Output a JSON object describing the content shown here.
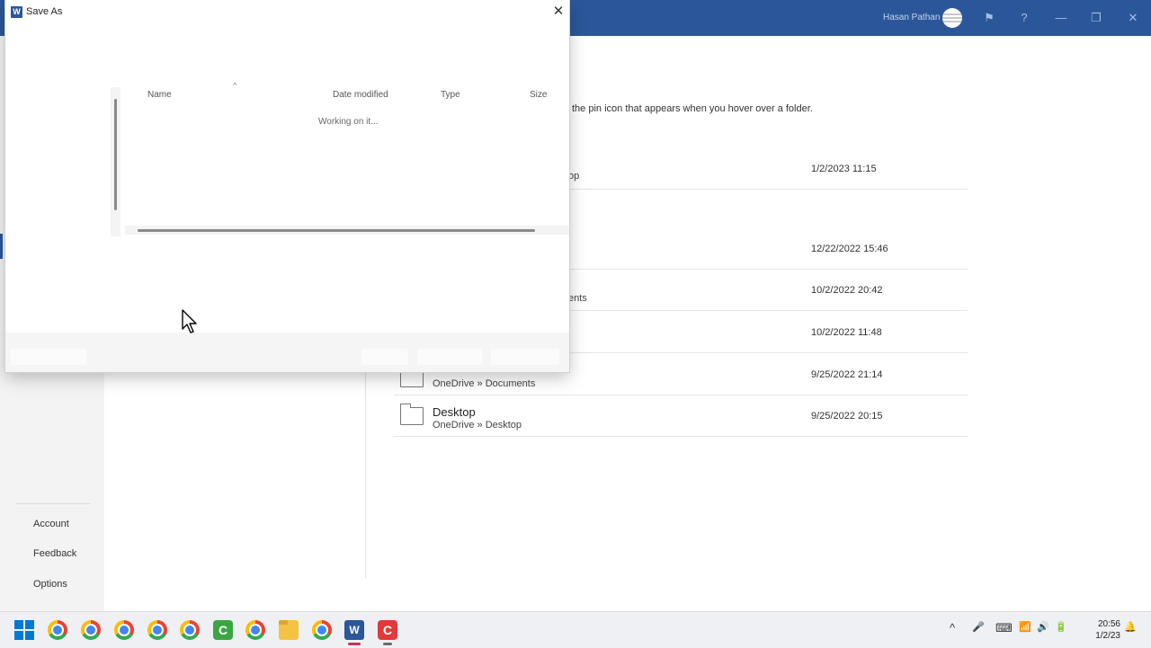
{
  "word_window": {
    "user_name": "Hasan Pathan",
    "title_buttons": {
      "feedback": "⚑",
      "help": "?",
      "minimize": "—",
      "restore": "❐",
      "close": "✕"
    }
  },
  "backstage": {
    "nav_items": [
      {
        "label": "Account"
      },
      {
        "label": "Feedback"
      },
      {
        "label": "Options"
      }
    ],
    "pin_hint_fragment": "the pin icon that appears when you hover over a folder.",
    "recent_folders": [
      {
        "name": "",
        "path": "op",
        "date": "1/2/2023 11:15"
      },
      {
        "name": "",
        "path": "",
        "date": "12/22/2022 15:46"
      },
      {
        "name": "",
        "path": "ents",
        "date": "10/2/2022 20:42"
      },
      {
        "name": "",
        "path": "",
        "date": "10/2/2022 11:48"
      },
      {
        "name": "",
        "path": "OneDrive » Documents",
        "date": "9/25/2022 21:14"
      },
      {
        "name": "Desktop",
        "path": "OneDrive » Desktop",
        "date": "9/25/2022 20:15"
      }
    ]
  },
  "dialog": {
    "title": "Save As",
    "app_icon_letter": "W",
    "close_glyph": "✕",
    "columns": [
      "Name",
      "Date modified",
      "Type",
      "Size"
    ],
    "sort_glyph": "^",
    "status_text": "Working on it..."
  },
  "taskbar": {
    "apps": [
      {
        "name": "start",
        "icon": "windows-logo-icon"
      },
      {
        "name": "chrome-1",
        "icon": "chrome-icon"
      },
      {
        "name": "chrome-2",
        "icon": "chrome-icon"
      },
      {
        "name": "chrome-3",
        "icon": "chrome-icon"
      },
      {
        "name": "chrome-4",
        "icon": "chrome-icon"
      },
      {
        "name": "chrome-5",
        "icon": "chrome-icon"
      },
      {
        "name": "camtasia-recorder",
        "icon": "camtasia-green-icon"
      },
      {
        "name": "chrome-6",
        "icon": "chrome-icon"
      },
      {
        "name": "file-explorer",
        "icon": "folder-icon"
      },
      {
        "name": "chrome-7",
        "icon": "chrome-icon"
      },
      {
        "name": "word",
        "icon": "word-icon"
      },
      {
        "name": "camtasia-editor",
        "icon": "camtasia-red-icon"
      }
    ],
    "word_letter": "W",
    "camtasia_letter": "C",
    "tray_glyphs": {
      "chevron": "^",
      "mic": "🎤",
      "keyboard": "⌨",
      "wifi": "📶",
      "volume": "🔊",
      "battery": "🔋",
      "notification": "🔔"
    },
    "time": "20:56",
    "date": "1/2/23"
  },
  "colors": {
    "word_blue": "#2b579a",
    "windows_blue": "#0078d4"
  }
}
